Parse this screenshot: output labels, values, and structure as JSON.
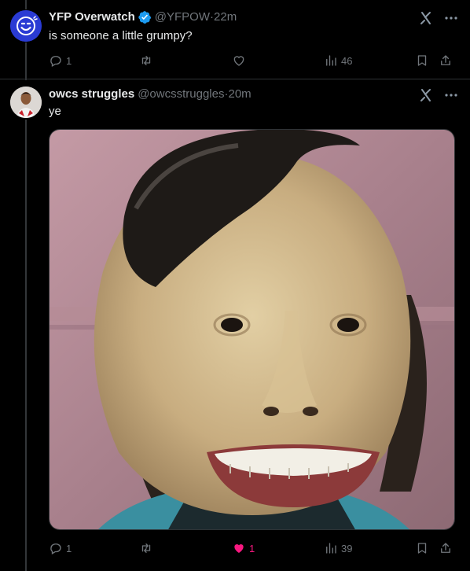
{
  "tweets": [
    {
      "display_name": "YFP Overwatch",
      "handle": "@YFPOW",
      "time": "22m",
      "text": "is someone a little grumpy?",
      "replies": "1",
      "reposts": "",
      "likes": "",
      "views": "46",
      "verified": true
    },
    {
      "display_name": "owcs struggles",
      "handle": "@owcsstruggles",
      "time": "20m",
      "text": "ye",
      "replies": "1",
      "reposts": "",
      "likes": "1",
      "views": "39",
      "liked": true
    }
  ],
  "separator": " · ",
  "colors": {
    "background": "#000000",
    "text": "#e7e9ea",
    "muted": "#71767b",
    "verified": "#1d9bf0",
    "like": "#f91880",
    "avatar_yfp": "#2a3bd4"
  }
}
